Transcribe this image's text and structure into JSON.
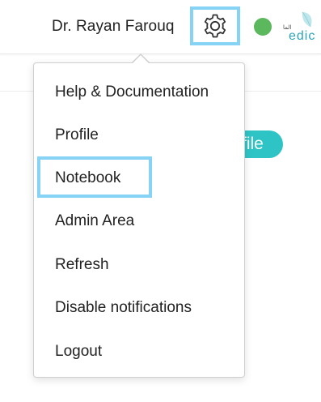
{
  "header": {
    "user_name": "Dr. Rayan Farouq",
    "settings_icon": "gear-icon",
    "status_color": "#5cb85c",
    "brand": {
      "small_text": "ﺍﻟﻤﺎ",
      "text": "edic"
    }
  },
  "background": {
    "profile_button_label": "file",
    "accent_color": "#2ec4c6"
  },
  "menu": {
    "items": [
      {
        "label": "Help & Documentation"
      },
      {
        "label": "Profile"
      },
      {
        "label": "Notebook"
      },
      {
        "label": "Admin Area"
      },
      {
        "label": "Refresh"
      },
      {
        "label": "Disable notifications"
      },
      {
        "label": "Logout"
      }
    ]
  },
  "colors": {
    "highlight": "#86d3f5",
    "brand": "#2ea3b8"
  }
}
